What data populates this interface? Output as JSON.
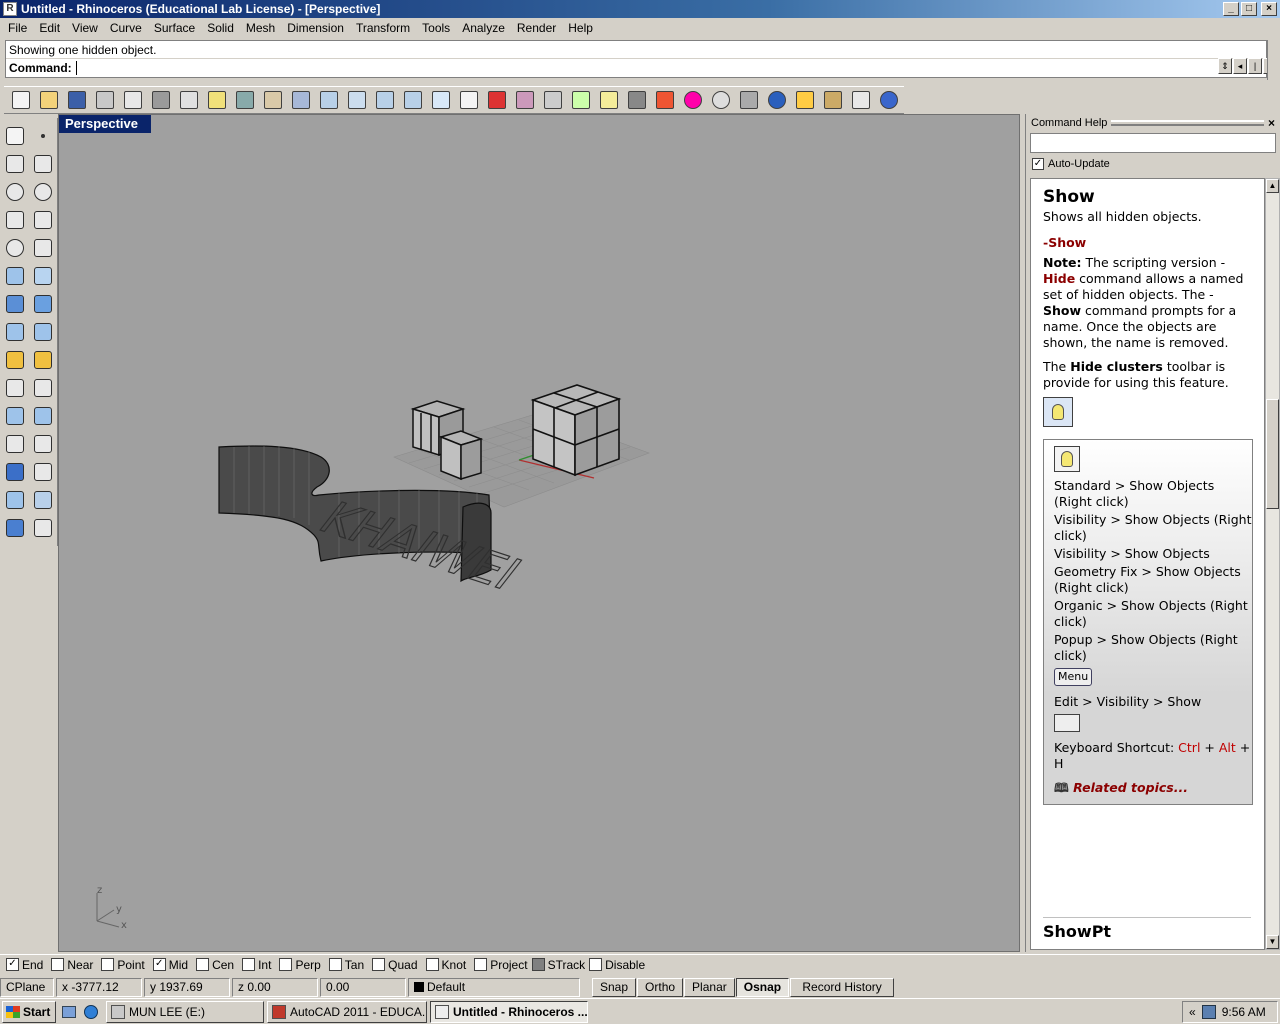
{
  "window": {
    "title": "Untitled - Rhinoceros (Educational Lab License) - [Perspective]"
  },
  "menu": [
    "File",
    "Edit",
    "View",
    "Curve",
    "Surface",
    "Solid",
    "Mesh",
    "Dimension",
    "Transform",
    "Tools",
    "Analyze",
    "Render",
    "Help"
  ],
  "command": {
    "history": "Showing one hidden object.",
    "prompt_label": "Command:"
  },
  "toolbar_icons": [
    "new-icon",
    "open-icon",
    "save-icon",
    "print-icon",
    "import-icon",
    "cut-icon",
    "copy-icon",
    "paste-icon",
    "undo-icon",
    "pan-icon",
    "rotate-view-icon",
    "zoom-window-icon",
    "zoom-dynamic-icon",
    "zoom-extents-icon",
    "zoom-selected-icon",
    "undo-view-icon",
    "four-viewports-icon",
    "car-icon",
    "grid-icon",
    "osnap-icon",
    "gumball-icon",
    "light-icon",
    "lock-icon",
    "layers-icon",
    "color-wheel-icon",
    "wireframe-sphere-icon",
    "render-mesh-icon",
    "render-sphere-icon",
    "render-light-icon",
    "settings-icon",
    "cplane-icon",
    "help-icon"
  ],
  "left_tools": [
    "select-arrow-icon",
    "point-icon",
    "polyline-icon",
    "curve-points-icon",
    "circle-icon",
    "ellipse-icon",
    "arc-icon",
    "rectangle-icon",
    "polygon-icon",
    "fillet-curve-icon",
    "surface-icon",
    "sweep-icon",
    "box-icon",
    "boolean-icon",
    "cylinder-icon",
    "mesh-icon",
    "explode-icon",
    "trim-icon",
    "move-icon",
    "array-icon",
    "group-icon",
    "points-on-icon",
    "curve-edit-icon",
    "edit-points-icon",
    "text-icon",
    "dimension-icon",
    "analyze-icon",
    "transform-icon",
    "render-icon",
    "history-icon"
  ],
  "viewport": {
    "label": "Perspective",
    "text_object": "KHAIWEI",
    "axis": {
      "z": "z",
      "y": "y",
      "x": "x"
    }
  },
  "help": {
    "panel_title": "Command Help",
    "auto_update_label": "Auto-Update",
    "title": "Show",
    "summary": "Shows all hidden objects.",
    "dash_command": "-Show",
    "note_label": "Note:",
    "note_text_1": " The scripting version -",
    "note_hide": "Hide",
    "note_text_2": " command allows a named set of hidden objects. The -",
    "note_show": "Show",
    "note_text_3": " command prompts for a name. Once the objects are shown, the name is removed.",
    "clusters_text_1": "The ",
    "clusters_bold": "Hide clusters",
    "clusters_text_2": " toolbar is provide for using this feature.",
    "toolbar_locations": [
      "Standard > Show Objects (Right click)",
      "Visibility > Show Objects (Right click)",
      "Visibility > Show Objects",
      "Geometry Fix > Show Objects (Right click)",
      "Organic > Show Objects (Right click)",
      "Popup > Show Objects (Right click)"
    ],
    "menu_chip": "Menu",
    "menu_path": "Edit > Visibility > Show",
    "keyboard_label": "Keyboard Shortcut: ",
    "kb_ctrl": "Ctrl",
    "kb_plus1": " +",
    "kb_alt": "Alt",
    "kb_rest": " + H",
    "related": "Related topics...",
    "next_title": "ShowPt"
  },
  "osnap": [
    {
      "label": "End",
      "checked": true
    },
    {
      "label": "Near",
      "checked": false
    },
    {
      "label": "Point",
      "checked": false
    },
    {
      "label": "Mid",
      "checked": true
    },
    {
      "label": "Cen",
      "checked": false
    },
    {
      "label": "Int",
      "checked": false
    },
    {
      "label": "Perp",
      "checked": false
    },
    {
      "label": "Tan",
      "checked": false
    },
    {
      "label": "Quad",
      "checked": false
    },
    {
      "label": "Knot",
      "checked": false
    },
    {
      "label": "Project",
      "checked": false
    },
    {
      "label": "STrack",
      "checked": false
    },
    {
      "label": "Disable",
      "checked": false
    }
  ],
  "status": {
    "cplane": "CPlane",
    "x": "x -3777.12",
    "y": "y 1937.69",
    "z": "z 0.00",
    "dist": "0.00",
    "layer": "Default",
    "snap": "Snap",
    "ortho": "Ortho",
    "planar": "Planar",
    "osnap": "Osnap",
    "record_history": "Record History"
  },
  "taskbar": {
    "start": "Start",
    "tasks": [
      "MUN LEE (E:)",
      "AutoCAD 2011 - EDUCA...",
      "Untitled - Rhinoceros ..."
    ],
    "time": "9:56 AM",
    "tray_chevron": "«"
  }
}
